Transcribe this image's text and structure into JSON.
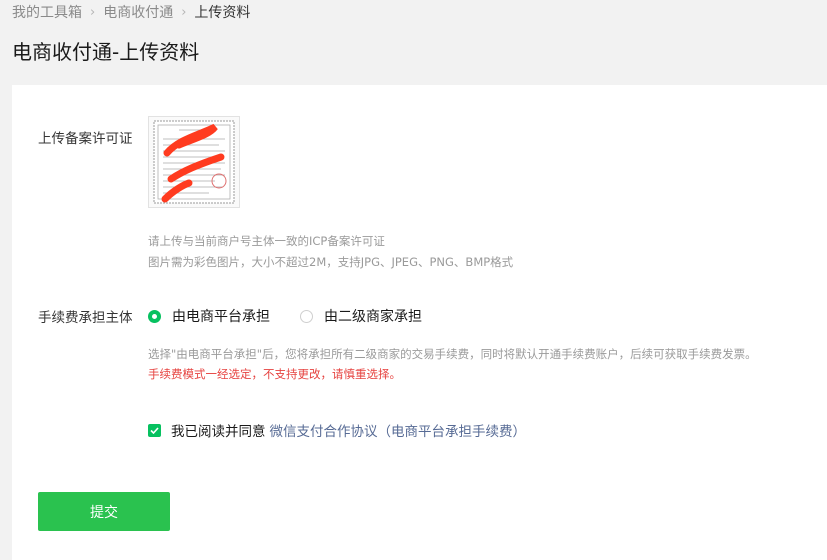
{
  "breadcrumb": {
    "items": [
      "我的工具箱",
      "电商收付通",
      "上传资料"
    ]
  },
  "page": {
    "title": "电商收付通-上传资料"
  },
  "upload": {
    "label": "上传备案许可证",
    "hint_line1": "请上传与当前商户号主体一致的ICP备案许可证",
    "hint_line2": "图片需为彩色图片，大小不超过2M，支持JPG、JPEG、PNG、BMP格式"
  },
  "fee": {
    "label": "手续费承担主体",
    "options": [
      {
        "label": "由电商平台承担",
        "checked": true
      },
      {
        "label": "由二级商家承担",
        "checked": false
      }
    ],
    "hint": "选择\"由电商平台承担\"后，您将承担所有二级商家的交易手续费，同时将默认开通手续费账户，后续可获取手续费发票。",
    "warning": "手续费模式一经选定，不支持更改，请慎重选择。"
  },
  "agreement": {
    "checked": true,
    "text": "我已阅读并同意",
    "link": "微信支付合作协议（电商平台承担手续费）"
  },
  "submit": {
    "label": "提交"
  },
  "colors": {
    "accent": "#07c160",
    "button": "#2ac24f",
    "link": "#576b95",
    "warning": "#e64340"
  }
}
